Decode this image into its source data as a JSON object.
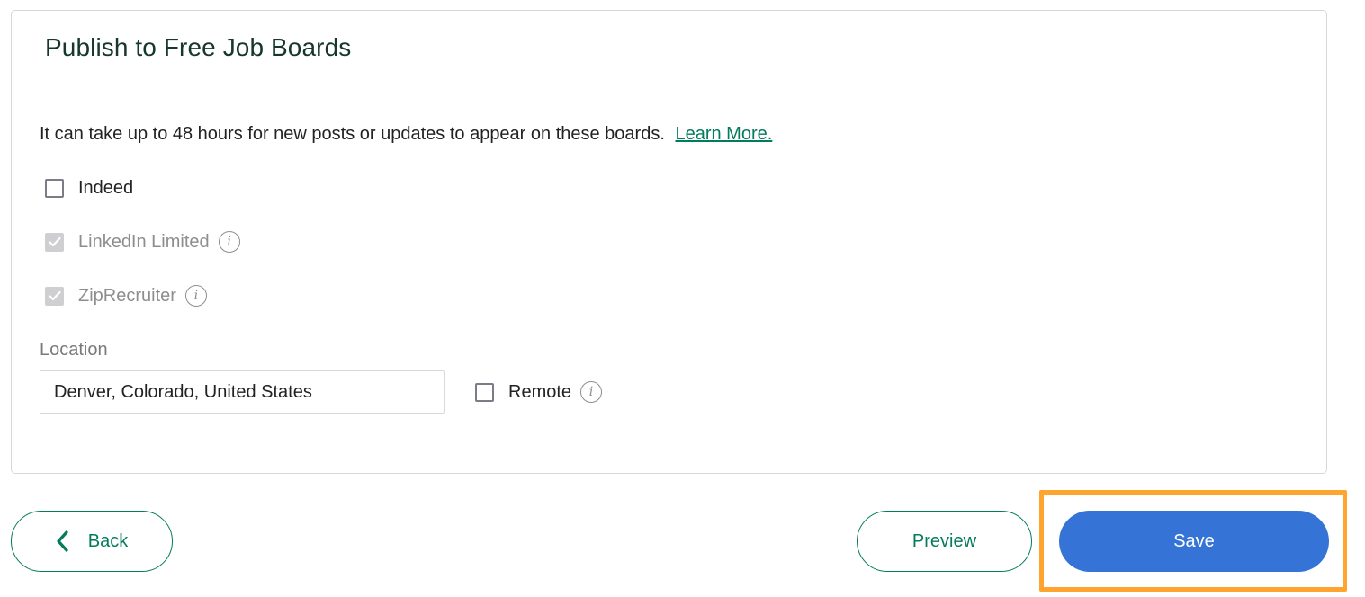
{
  "section": {
    "title": "Publish to Free Job Boards",
    "notice_text": "It can take up to 48 hours for new posts or updates to appear on these boards.",
    "learn_more_label": "Learn More."
  },
  "job_boards": [
    {
      "label": "Indeed",
      "checked": false,
      "disabled": false,
      "has_info": false
    },
    {
      "label": "LinkedIn Limited",
      "checked": true,
      "disabled": true,
      "has_info": true,
      "icon": "info-icon"
    },
    {
      "label": "ZipRecruiter",
      "checked": true,
      "disabled": true,
      "has_info": true,
      "icon": "info-icon"
    }
  ],
  "location": {
    "label": "Location",
    "value": "Denver, Colorado, United States",
    "remote_label": "Remote",
    "remote_checked": false,
    "remote_icon": "info-icon"
  },
  "footer": {
    "back_label": "Back",
    "back_icon": "chevron-left-icon",
    "preview_label": "Preview",
    "save_label": "Save"
  },
  "colors": {
    "brand_green": "#047b5b",
    "title_dark_green": "#15372c",
    "save_blue": "#3574d6",
    "highlight_orange": "#ffa42f"
  }
}
